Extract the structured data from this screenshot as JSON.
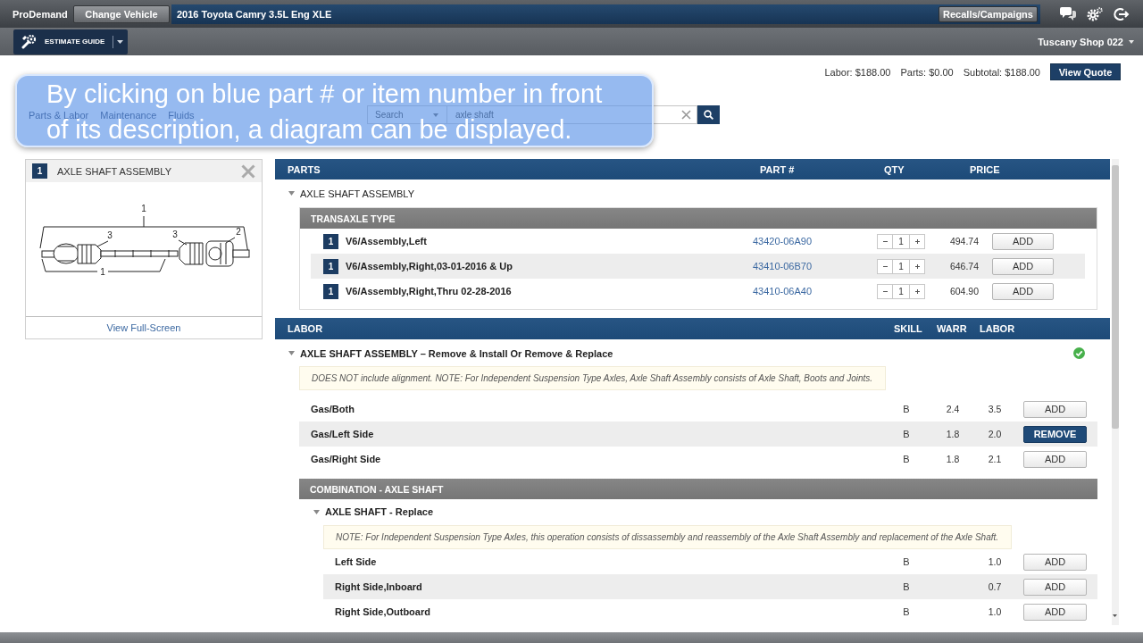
{
  "header": {
    "brand": "ProDemand",
    "change_vehicle": "Change Vehicle",
    "vehicle": "2016 Toyota Camry 3.5L Eng XLE",
    "recalls": "Recalls/Campaigns"
  },
  "toolbar": {
    "estimate_guide": "ESTIMATE GUIDE",
    "shop": "Tuscany Shop 022"
  },
  "quote": {
    "labor": "Labor: $188.00",
    "parts": "Parts: $0.00",
    "subtotal": "Subtotal: $188.00",
    "button": "View Quote"
  },
  "nav": {
    "links": [
      "Parts & Labor",
      "Maintenance",
      "Fluids"
    ]
  },
  "search": {
    "scope": "Search",
    "value": "axle shaft"
  },
  "caption": "By clicking on blue part # or item number in front of its description, a diagram can be displayed.",
  "diagram": {
    "index": "1",
    "title": "AXLE SHAFT ASSEMBLY",
    "callouts": [
      "1",
      "3",
      "3",
      "2",
      "1"
    ],
    "link": "View Full-Screen"
  },
  "parts": {
    "columns": [
      "PARTS",
      "PART #",
      "QTY",
      "PRICE"
    ],
    "group": {
      "title": "AXLE SHAFT ASSEMBLY",
      "expanded": true
    },
    "section": "TRANSAXLE TYPE",
    "rows": [
      {
        "index": "1",
        "description": "V6/Assembly,Left",
        "part_no": "43420-06A90",
        "qty": "1",
        "price": "494.74",
        "action": "ADD"
      },
      {
        "index": "1",
        "description": "V6/Assembly,Right,03-01-2016 & Up",
        "part_no": "43410-06B70",
        "qty": "1",
        "price": "646.74",
        "action": "ADD"
      },
      {
        "index": "1",
        "description": "V6/Assembly,Right,Thru 02-28-2016",
        "part_no": "43410-06A40",
        "qty": "1",
        "price": "604.90",
        "action": "ADD"
      }
    ]
  },
  "labor": {
    "columns": [
      "LABOR",
      "SKILL",
      "WARR",
      "LABOR"
    ],
    "operations": [
      {
        "title": "AXLE SHAFT ASSEMBLY – Remove & Install Or Remove & Replace",
        "expanded": true,
        "verified": true,
        "note": "DOES NOT include alignment. NOTE: For Independent Suspension Type Axles, Axle Shaft Assembly consists of Axle Shaft, Boots and Joints.",
        "rows": [
          {
            "name": "Gas/Both",
            "skill": "B",
            "warr": "2.4",
            "labor": "3.5",
            "action": "ADD",
            "added": false
          },
          {
            "name": "Gas/Left Side",
            "skill": "B",
            "warr": "1.8",
            "labor": "2.0",
            "action": "REMOVE",
            "added": true
          },
          {
            "name": "Gas/Right Side",
            "skill": "B",
            "warr": "1.8",
            "labor": "2.1",
            "action": "ADD",
            "added": false
          }
        ]
      }
    ],
    "sections": [
      {
        "title": "COMBINATION - AXLE SHAFT",
        "operations": [
          {
            "title": "AXLE SHAFT - Replace",
            "expanded": true,
            "note": "NOTE: For Independent Suspension Type Axles, this operation consists of dissassembly and reassembly of the Axle Shaft Assembly and replacement of the Axle Shaft.",
            "rows": [
              {
                "name": "Left Side",
                "skill": "B",
                "labor": "1.0",
                "action": "ADD",
                "added": false
              },
              {
                "name": "Right Side,Inboard",
                "skill": "B",
                "labor": "0.7",
                "action": "ADD",
                "added": false
              },
              {
                "name": "Right Side,Outboard",
                "skill": "B",
                "labor": "1.0",
                "action": "ADD",
                "added": false
              }
            ]
          }
        ]
      }
    ]
  }
}
